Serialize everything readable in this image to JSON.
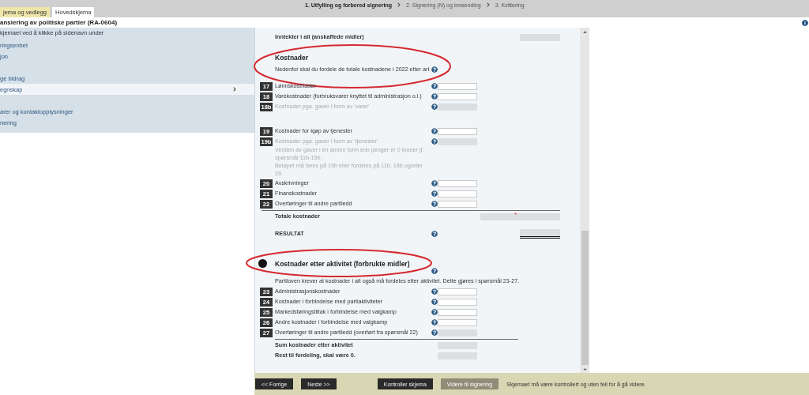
{
  "top_tabs": [
    {
      "label": "jema og vedlegg",
      "selected": false
    },
    {
      "label": "Hovedskjema",
      "selected": true
    }
  ],
  "steps": [
    {
      "label": "1. Utfylling og forbered signering",
      "active": true
    },
    {
      "label": "2. Signering (N) og innsending",
      "active": false
    },
    {
      "label": "3. Kvittering",
      "active": false
    }
  ],
  "form_title": "ansiering av politiske partier (RA-0604)",
  "sidebar": {
    "intro": "kjemaet ved å klikke på sidenavn under",
    "items": [
      {
        "label": "ringsenhet",
        "selected": false
      },
      {
        "label": "jon",
        "selected": false
      },
      {
        "label": "ge bidrag",
        "selected": false,
        "spaced": true
      },
      {
        "label": "egnskap",
        "selected": true
      },
      {
        "label": "arer og kontaktopplysninger",
        "selected": false,
        "spaced": true
      },
      {
        "label": "nering",
        "selected": false
      }
    ]
  },
  "rows": [
    {
      "kind": "income",
      "label": "Inntekter i alt (anskaffede midler)"
    },
    {
      "kind": "heading",
      "label": "Kostnader",
      "bullet": false,
      "help": false,
      "circled": true
    },
    {
      "kind": "description",
      "label": "Nedenfor skal du fordele de totale kostnadene i 2022 etter art",
      "help": true
    },
    {
      "kind": "item",
      "number": "17",
      "label": "Lønnskostnader",
      "readonly": false,
      "disabled": false
    },
    {
      "kind": "item",
      "number": "18",
      "label": "Varekostnader (forbruksvarer knyttet til administrasjon o.l.)",
      "readonly": false,
      "disabled": false
    },
    {
      "kind": "item",
      "number": "18b",
      "label": "Kostnader pga. gaver i form av 'varer'",
      "readonly": true,
      "disabled": true
    },
    {
      "kind": "item",
      "number": "19",
      "label": "Kostnader for kjøp av tjenester",
      "readonly": false,
      "disabled": false,
      "spaced": true
    },
    {
      "kind": "item",
      "number": "19b",
      "label": "Kostnader pga. gaver i form av 'tjenester'.",
      "readonly": true,
      "disabled": true
    },
    {
      "kind": "note",
      "label": "Verdien av gaver i en annen form enn penger er 0 kroner jf. spørsmål 11b-15b."
    },
    {
      "kind": "note",
      "label": "Beløpet må føres på 19b eller fordeles på 11b, 18b og/eller 29."
    },
    {
      "kind": "item",
      "number": "20",
      "label": "Avskrivninger",
      "readonly": false,
      "disabled": false
    },
    {
      "kind": "item",
      "number": "21",
      "label": "Finanskostnader",
      "readonly": false,
      "disabled": false
    },
    {
      "kind": "item",
      "number": "22",
      "label": "Overføringer til andre partiledd",
      "readonly": false,
      "disabled": false
    },
    {
      "kind": "total",
      "label": "Totale kostnader",
      "required_mark": "*"
    },
    {
      "kind": "result",
      "label": "RESULTAT"
    },
    {
      "kind": "heading",
      "label": "Kostnader etter aktivitet (forbrukte midler)",
      "bullet": true,
      "help": true,
      "circled": true
    },
    {
      "kind": "wide-description",
      "label": "Partiloven krever at kostnader i alt også må fordeles etter aktivitet. Dette gjøres i spørsmål 23-27."
    },
    {
      "kind": "item",
      "number": "23",
      "label": "Administrasjonskostnader",
      "readonly": false,
      "disabled": false
    },
    {
      "kind": "item",
      "number": "24",
      "label": "Kostnader i forbindelse med partiaktiviteter",
      "readonly": false,
      "disabled": false
    },
    {
      "kind": "item",
      "number": "25",
      "label": "Markedsføringstiltak i forbindelse med valgkamp",
      "readonly": false,
      "disabled": false
    },
    {
      "kind": "item",
      "number": "26",
      "label": "Andre kostnader i forbindelse med valgkamp",
      "readonly": false,
      "disabled": false
    },
    {
      "kind": "item",
      "number": "27",
      "label": "Overføringer til andre partiledd (overført fra spørsmål 22)",
      "readonly": true,
      "disabled": false
    },
    {
      "kind": "sum",
      "label": "Sum kostnader etter aktivitet"
    },
    {
      "kind": "sum",
      "label": "Rest til fordeling, skal være 0."
    }
  ],
  "footer": {
    "buttons": [
      {
        "label": "<< Forrige",
        "disabled": false
      },
      {
        "label": "Neste >>",
        "disabled": false
      },
      {
        "label": "Kontroller skjema",
        "disabled": false
      },
      {
        "label": "Videre til signering",
        "disabled": true
      }
    ],
    "message": "Skjemaet må være kontrollert og uten feil for å gå videre."
  }
}
